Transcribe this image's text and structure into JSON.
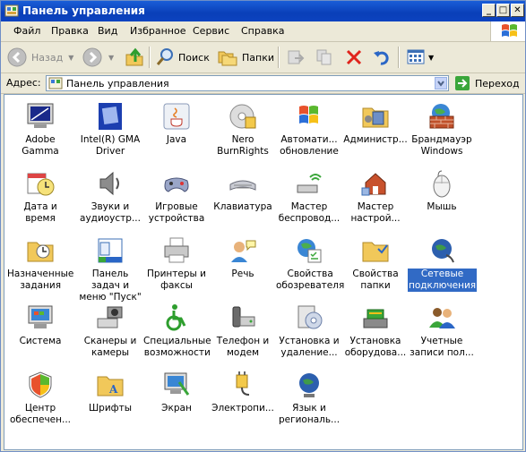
{
  "window": {
    "title": "Панель управления"
  },
  "menu": [
    "Файл",
    "Правка",
    "Вид",
    "Избранное",
    "Сервис",
    "Справка"
  ],
  "toolbar": {
    "back": "Назад",
    "search": "Поиск",
    "folders": "Папки"
  },
  "address": {
    "label": "Адрес:",
    "value": "Панель управления",
    "go": "Переход"
  },
  "items": [
    {
      "label": "Adobe Gamma",
      "icon": "monitor-gamma-icon"
    },
    {
      "label": "Intel(R) GMA Driver",
      "icon": "intel-gma-icon"
    },
    {
      "label": "Java",
      "icon": "java-icon"
    },
    {
      "label": "Nero BurnRights",
      "icon": "nero-icon"
    },
    {
      "label": "Автомати... обновление",
      "icon": "windows-update-icon"
    },
    {
      "label": "Администр...",
      "icon": "admin-tools-icon"
    },
    {
      "label": "Брандмауэр Windows",
      "icon": "firewall-icon"
    },
    {
      "label": "Дата и время",
      "icon": "calendar-clock-icon"
    },
    {
      "label": "Звуки и аудиоустр...",
      "icon": "speaker-icon"
    },
    {
      "label": "Игровые устройства",
      "icon": "gamepad-icon"
    },
    {
      "label": "Клавиатура",
      "icon": "keyboard-icon"
    },
    {
      "label": "Мастер беспровод...",
      "icon": "wireless-icon"
    },
    {
      "label": "Мастер настрой...",
      "icon": "network-setup-icon"
    },
    {
      "label": "Мышь",
      "icon": "mouse-icon"
    },
    {
      "label": "Назначенные задания",
      "icon": "scheduled-tasks-icon"
    },
    {
      "label": "Панель задач и меню \"Пуск\"",
      "icon": "taskbar-icon"
    },
    {
      "label": "Принтеры и факсы",
      "icon": "printer-icon"
    },
    {
      "label": "Речь",
      "icon": "speech-icon"
    },
    {
      "label": "Свойства обозревателя",
      "icon": "internet-options-icon"
    },
    {
      "label": "Свойства папки",
      "icon": "folder-options-icon"
    },
    {
      "label": "Сетевые подключения",
      "icon": "network-connections-icon"
    },
    {
      "label": "Система",
      "icon": "system-icon"
    },
    {
      "label": "Сканеры и камеры",
      "icon": "scanner-camera-icon"
    },
    {
      "label": "Специальные возможности",
      "icon": "accessibility-icon"
    },
    {
      "label": "Телефон и модем",
      "icon": "phone-modem-icon"
    },
    {
      "label": "Установка и удаление...",
      "icon": "add-remove-icon"
    },
    {
      "label": "Установка оборудова...",
      "icon": "add-hardware-icon"
    },
    {
      "label": "Учетные записи пол...",
      "icon": "user-accounts-icon"
    },
    {
      "label": "Центр обеспечен...",
      "icon": "security-center-icon"
    },
    {
      "label": "Шрифты",
      "icon": "fonts-folder-icon"
    },
    {
      "label": "Экран",
      "icon": "display-icon"
    },
    {
      "label": "Электропи...",
      "icon": "power-icon"
    },
    {
      "label": "Язык и региональ...",
      "icon": "globe-icon"
    }
  ],
  "selected_item": "Сетевые подключения",
  "colors": {
    "titlebar": "#0a3fb8",
    "selection": "#316ac5",
    "chrome": "#ECE9D8"
  }
}
